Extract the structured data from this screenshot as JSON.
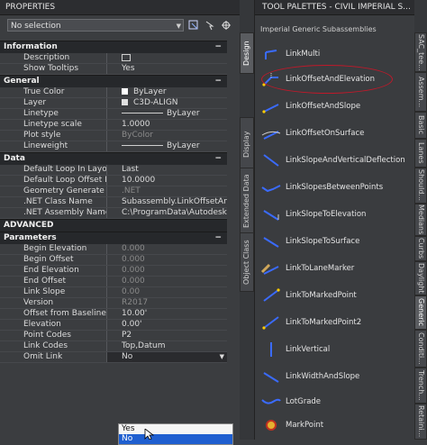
{
  "properties": {
    "title": "PROPERTIES",
    "selection": "No selection",
    "sections": {
      "information": {
        "label": "Information",
        "rows": [
          {
            "label": "Description",
            "value": ""
          },
          {
            "label": "Show Tooltips",
            "value": "Yes"
          }
        ]
      },
      "general": {
        "label": "General",
        "rows": [
          {
            "label": "True Color",
            "value": "ByLayer"
          },
          {
            "label": "Layer",
            "value": "C3D-ALIGN"
          },
          {
            "label": "Linetype",
            "value": "ByLayer"
          },
          {
            "label": "Linetype scale",
            "value": "1.0000"
          },
          {
            "label": "Plot style",
            "value": "ByColor"
          },
          {
            "label": "Lineweight",
            "value": "ByLayer"
          }
        ]
      },
      "data": {
        "label": "Data",
        "rows": [
          {
            "label": "Default Loop In Layout M...",
            "value": "Last"
          },
          {
            "label": "Default Loop Offset In La...",
            "value": "10.0000"
          },
          {
            "label": "Geometry Generate Mode",
            "value": ".NET"
          },
          {
            "label": ".NET Class Name",
            "value": "Subassembly.LinkOffsetAndEl..."
          },
          {
            "label": ".NET Assembly Name",
            "value": "C:\\ProgramData\\Autodesk\\C3..."
          }
        ]
      },
      "advanced": {
        "label": "ADVANCED"
      },
      "parameters": {
        "label": "Parameters",
        "rows": [
          {
            "label": "Begin Elevation",
            "value": "0.000"
          },
          {
            "label": "Begin Offset",
            "value": "0.000"
          },
          {
            "label": "End Elevation",
            "value": "0.000"
          },
          {
            "label": "End Offset",
            "value": "0.000"
          },
          {
            "label": "Link Slope",
            "value": "0.00"
          },
          {
            "label": "Version",
            "value": "R2017"
          },
          {
            "label": "Offset from Baseline",
            "value": "10.00'"
          },
          {
            "label": "Elevation",
            "value": "0.00'"
          },
          {
            "label": "Point Codes",
            "value": "P2"
          },
          {
            "label": "Link Codes",
            "value": "Top,Datum"
          },
          {
            "label": "Omit Link",
            "value": "No"
          }
        ]
      }
    },
    "dropdown_options": [
      "Yes",
      "No"
    ],
    "side_tabs": [
      "Design",
      "Display",
      "Extended Data",
      "Object Class"
    ]
  },
  "tool_palettes": {
    "title": "TOOL PALETTES - CIVIL IMPERIAL S...",
    "subtitle": "Imperial Generic Subassemblies",
    "tools": [
      "LinkMulti",
      "LinkOffsetAndElevation",
      "LinkOffsetAndSlope",
      "LinkOffsetOnSurface",
      "LinkSlopeAndVerticalDeflection",
      "LinkSlopesBetweenPoints",
      "LinkSlopeToElevation",
      "LinkSlopeToSurface",
      "LinkToLaneMarker",
      "LinkToMarkedPoint",
      "LinkToMarkedPoint2",
      "LinkVertical",
      "LinkWidthAndSlope",
      "LotGrade",
      "MarkPoint"
    ],
    "side_tabs": [
      "SAC_tee...",
      "Assem...",
      "Basic",
      "Lanes",
      "Should...",
      "Medians",
      "Curbs",
      "Daylight",
      "Generic",
      "Conditi...",
      "Trench...",
      "Retaini..."
    ]
  },
  "colors": {
    "highlight_ellipse": "#c0192a",
    "selection_blue": "#1f5fd0"
  }
}
